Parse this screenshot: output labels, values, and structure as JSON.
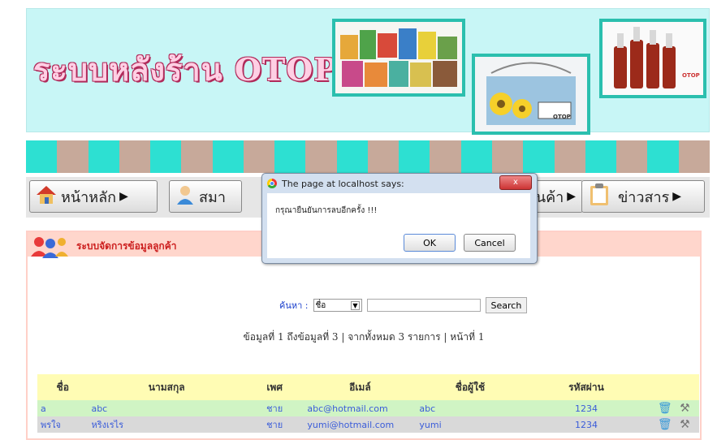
{
  "header": {
    "site_title": "ระบบหลังร้าน OTOP"
  },
  "photo_captions": {
    "photo2": "OTOP",
    "photo3": "OTOP"
  },
  "stripe_colors": [
    "#2de0d2",
    "#c7a99a",
    "#2de0d2",
    "#c7a99a",
    "#2de0d2",
    "#c7a99a",
    "#2de0d2",
    "#c7a99a",
    "#2de0d2",
    "#c7a99a",
    "#2de0d2",
    "#c7a99a",
    "#2de0d2",
    "#c7a99a",
    "#2de0d2",
    "#c7a99a",
    "#2de0d2",
    "#c7a99a",
    "#2de0d2",
    "#c7a99a",
    "#2de0d2",
    "#c7a99a"
  ],
  "nav": {
    "home": "หน้าหลัก",
    "members": "สมา",
    "products": "นค้า",
    "news": "ข่าวสาร"
  },
  "panel": {
    "title": "ระบบจัดการข้อมูลลูกค้า"
  },
  "search": {
    "label": "ค้นหา :",
    "field": "ชื่อ",
    "button": "Search"
  },
  "pager_text": "ข้อมูลที่ 1 ถึงข้อมูลที่ 3 | จากทั้งหมด 3 รายการ | หน้าที่ 1",
  "table": {
    "headers": [
      "ชื่อ",
      "นามสกุล",
      "เพศ",
      "อีเมล์",
      "ชื่อผู้ใช้",
      "รหัสผ่าน"
    ],
    "rows": [
      [
        "a",
        "abc",
        "ชาย",
        "abc@hotmail.com",
        "abc",
        "1234"
      ],
      [
        "พรใจ",
        "หริงเรไร",
        "ชาย",
        "yumi@hotmail.com",
        "yumi",
        "1234"
      ]
    ]
  },
  "dialog": {
    "title": "The page at localhost says:",
    "close": "x",
    "message": "กรุณายืนยันการลบอีกครั้ง !!!",
    "ok": "OK",
    "cancel": "Cancel"
  }
}
